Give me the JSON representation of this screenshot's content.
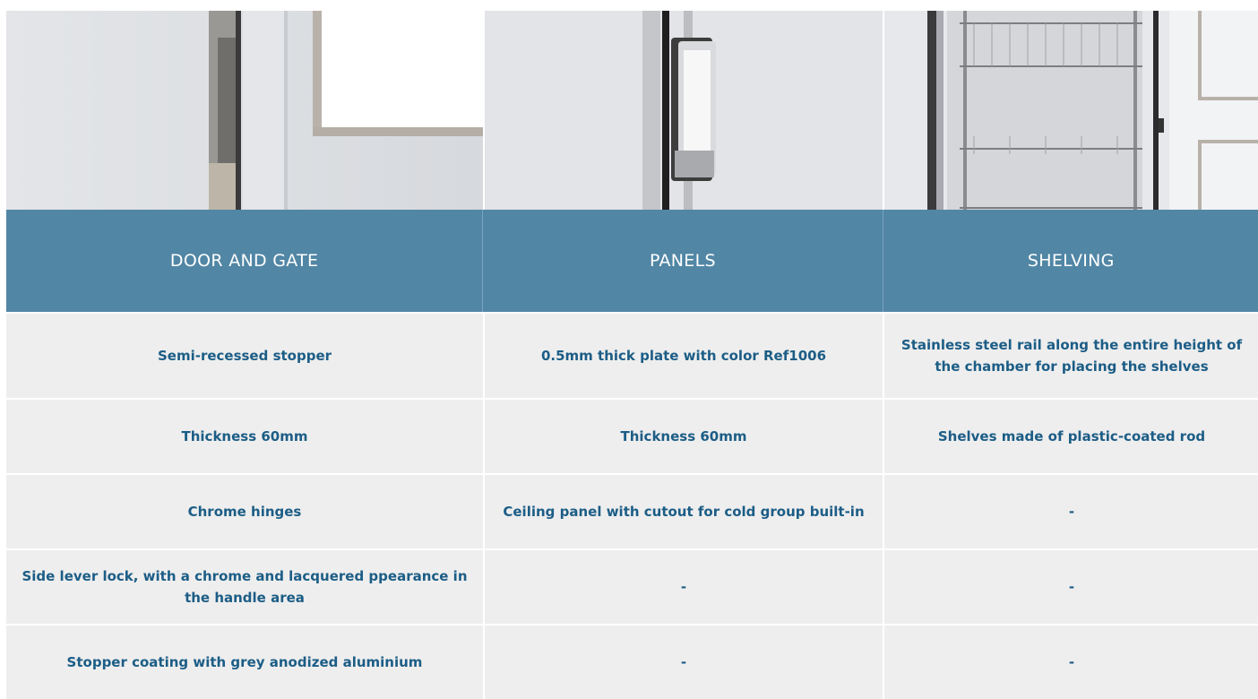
{
  "photos": [
    {
      "icon": "door-stopper-photo"
    },
    {
      "icon": "chrome-hinge-photo"
    },
    {
      "icon": "wire-shelving-photo"
    }
  ],
  "columns": [
    "DOOR AND GATE",
    "PANELS",
    "SHELVING"
  ],
  "rows": [
    [
      "Semi-recessed stopper",
      "0.5mm thick plate with color Ref1006",
      "Stainless steel rail along the entire height of the chamber for placing the shelves"
    ],
    [
      "Thickness 60mm",
      "Thickness 60mm",
      "Shelves made of plastic-coated rod"
    ],
    [
      "Chrome hinges",
      "Ceiling panel with cutout for cold group built-in",
      "-"
    ],
    [
      "Side lever lock, with a chrome and lacquered ppearance in the handle area",
      "-",
      "-"
    ],
    [
      "Stopper coating with grey anodized aluminium",
      "-",
      "-"
    ]
  ],
  "colors": {
    "header": "#5186a5",
    "cell_text": "#1c5d86",
    "row_bg": "#eeeeee"
  }
}
